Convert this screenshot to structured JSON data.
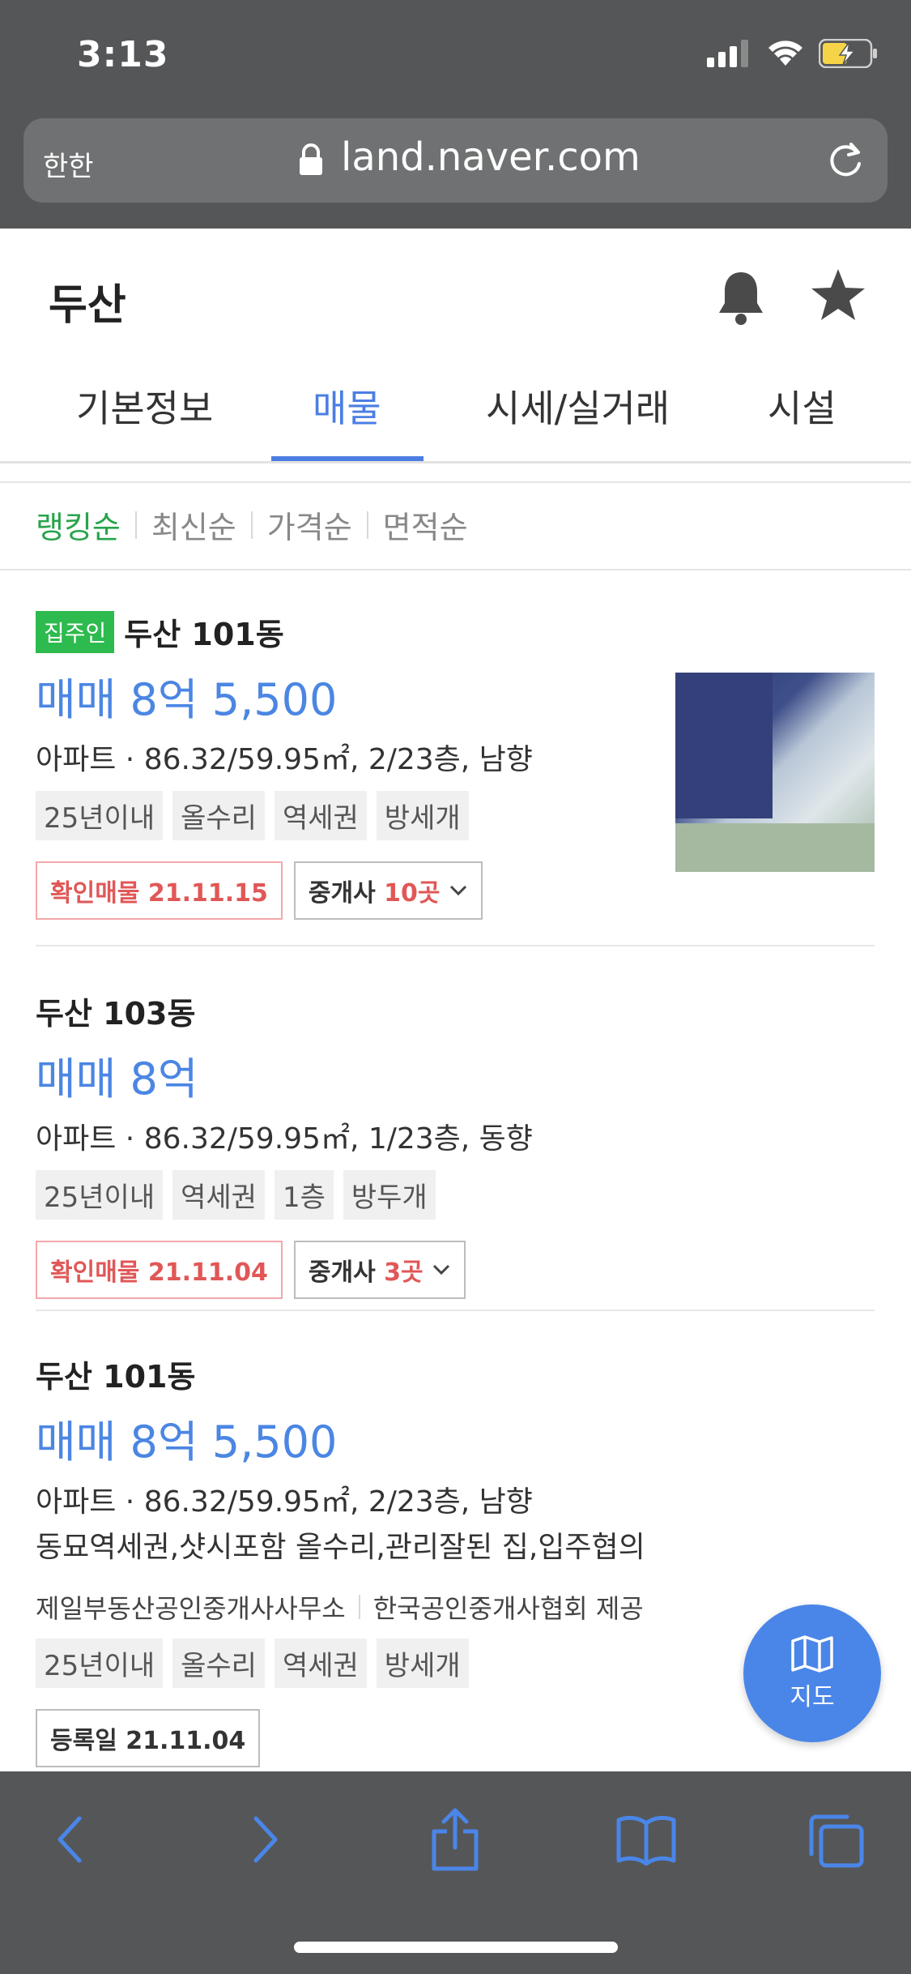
{
  "status_bar": {
    "time": "3:13"
  },
  "browser": {
    "text_size_label": "한한",
    "url": "land.naver.com"
  },
  "header": {
    "title": "두산"
  },
  "tabs": [
    {
      "label": "기본정보"
    },
    {
      "label": "매물"
    },
    {
      "label": "시세/실거래"
    },
    {
      "label": "시설"
    }
  ],
  "active_tab": "매물",
  "sort": [
    {
      "label": "랭킹순"
    },
    {
      "label": "최신순"
    },
    {
      "label": "가격순"
    },
    {
      "label": "면적순"
    }
  ],
  "listings": [
    {
      "badge": "집주인",
      "name": "두산 101동",
      "price": "매매 8억 5,500",
      "spec": "아파트 · 86.32/59.95㎡, 2/23층, 남향",
      "tags": [
        "25년이내",
        "올수리",
        "역세권",
        "방세개"
      ],
      "verify": "확인매물 21.11.15",
      "broker_prefix": "중개사 ",
      "broker_count": "10곳"
    },
    {
      "name": "두산 103동",
      "price": "매매 8억",
      "spec": "아파트 · 86.32/59.95㎡, 1/23층, 동향",
      "tags": [
        "25년이내",
        "역세권",
        "1층",
        "방두개"
      ],
      "verify": "확인매물 21.11.04",
      "broker_prefix": "중개사 ",
      "broker_count": "3곳"
    },
    {
      "name": "두산 101동",
      "price": "매매 8억 5,500",
      "spec": "아파트 · 86.32/59.95㎡, 2/23층, 남향",
      "desc": "동묘역세권,샷시포함 올수리,관리잘된 집,입주협의",
      "agent": "제일부동산공인중개사사무소",
      "provider": "한국공인중개사협회 제공",
      "tags": [
        "25년이내",
        "올수리",
        "역세권",
        "방세개"
      ],
      "registered": "등록일 21.11.04"
    }
  ],
  "map_button": {
    "label": "지도"
  },
  "colors": {
    "accent": "#4b7ee3",
    "sort_active": "#27a44b",
    "verify": "#e15757",
    "chrome": "#555657"
  },
  "icons": [
    "signal-icon",
    "wifi-icon",
    "battery-charging-icon",
    "lock-icon",
    "reload-icon",
    "bell-icon",
    "star-icon",
    "map-icon",
    "back-icon",
    "forward-icon",
    "share-icon",
    "bookmarks-icon",
    "tabs-icon"
  ]
}
